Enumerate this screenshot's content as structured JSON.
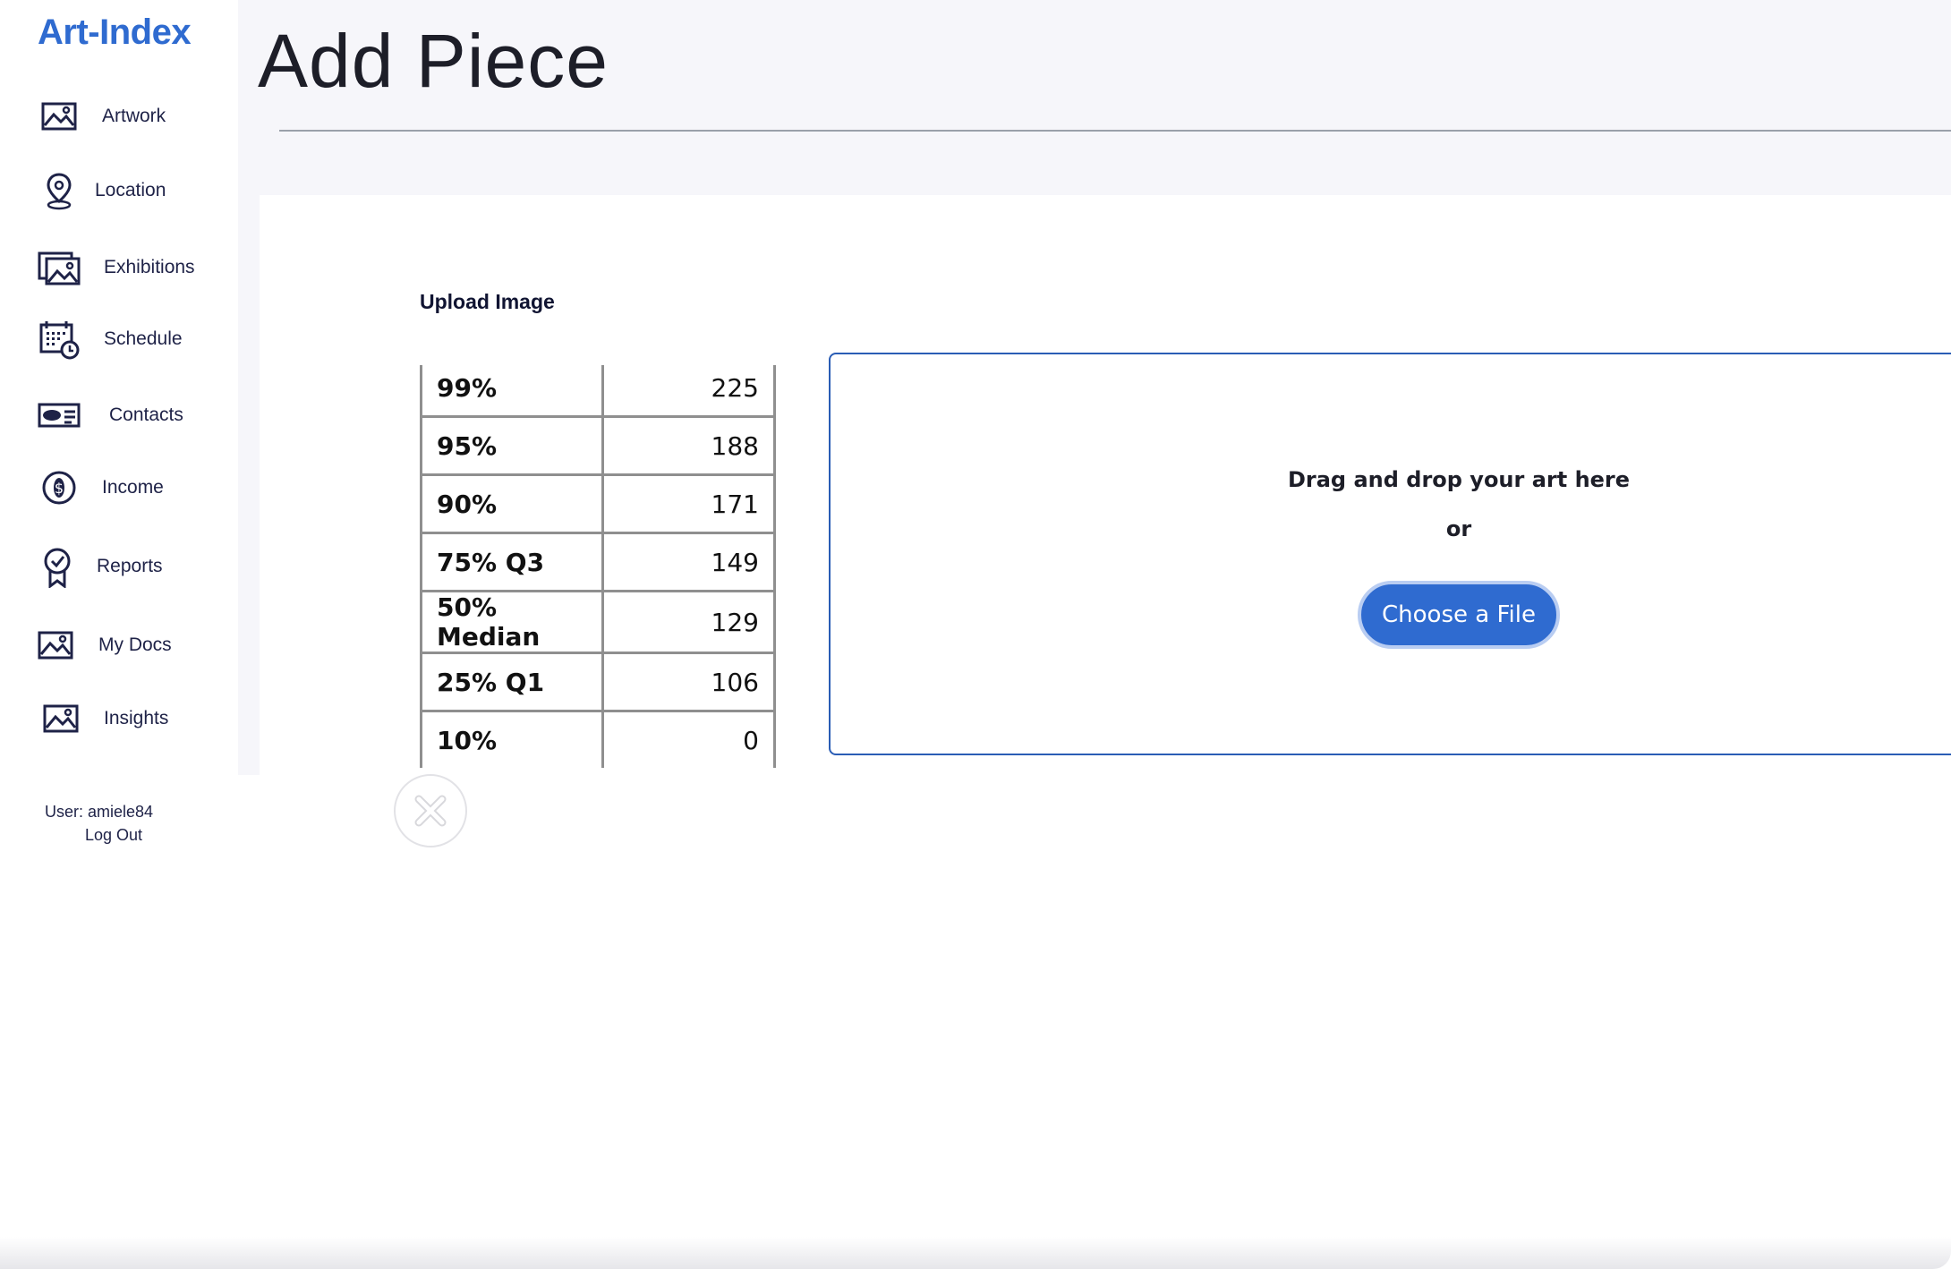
{
  "app": {
    "brand": "Art-Index"
  },
  "sidebar": {
    "items": [
      {
        "label": "Artwork",
        "icon": "artwork-image-icon"
      },
      {
        "label": "Location",
        "icon": "map-pin-icon"
      },
      {
        "label": "Exhibitions",
        "icon": "gallery-images-icon"
      },
      {
        "label": "Schedule",
        "icon": "calendar-clock-icon"
      },
      {
        "label": "Contacts",
        "icon": "contact-card-icon"
      },
      {
        "label": "Income",
        "icon": "dollar-coin-icon"
      },
      {
        "label": "Reports",
        "icon": "award-badge-icon"
      },
      {
        "label": "My Docs",
        "icon": "document-image-icon"
      },
      {
        "label": "Insights",
        "icon": "insights-image-icon"
      }
    ],
    "user_text": "User: amiele84",
    "logout_label": "Log Out"
  },
  "main": {
    "title": "Add Piece",
    "upload_label": "Upload Image",
    "preview_table": [
      {
        "k": "99%",
        "v": "225"
      },
      {
        "k": "95%",
        "v": "188"
      },
      {
        "k": "90%",
        "v": "171"
      },
      {
        "k": "75% Q3",
        "v": "149"
      },
      {
        "k": "50% Median",
        "v": "129"
      },
      {
        "k": "25% Q1",
        "v": "106"
      },
      {
        "k": "10%",
        "v": "0"
      }
    ],
    "remove_icon": "close-x-icon",
    "dropzone": {
      "prompt": "Drag and drop your art here",
      "or": "or",
      "button_label": "Choose a File"
    }
  },
  "colors": {
    "brand": "#2f6bd0",
    "header_bg": "#f6f6fa",
    "dropzone_border": "#2a5db5",
    "button_bg": "#2f6bd0"
  }
}
